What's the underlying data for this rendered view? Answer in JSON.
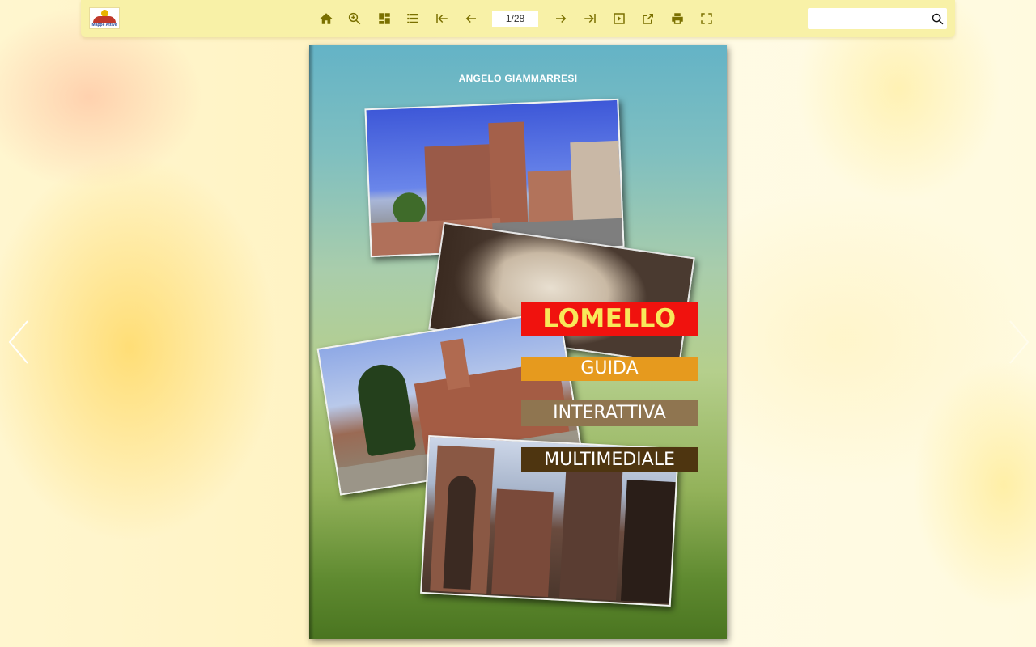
{
  "toolbar": {
    "logo_text": "Mappe Attive",
    "page_indicator": "1/28",
    "search_placeholder": "",
    "buttons": [
      {
        "name": "home",
        "icon": "home-icon"
      },
      {
        "name": "zoom",
        "icon": "zoom-in-icon"
      },
      {
        "name": "thumbnails",
        "icon": "thumbnails-icon"
      },
      {
        "name": "table-of-contents",
        "icon": "list-icon"
      },
      {
        "name": "first-page",
        "icon": "first-page-icon"
      },
      {
        "name": "previous-page",
        "icon": "arrow-left-icon"
      },
      {
        "name": "next-page",
        "icon": "arrow-right-icon"
      },
      {
        "name": "last-page",
        "icon": "last-page-icon"
      },
      {
        "name": "autoplay",
        "icon": "play-icon"
      },
      {
        "name": "share",
        "icon": "share-icon"
      },
      {
        "name": "print",
        "icon": "print-icon"
      },
      {
        "name": "fullscreen",
        "icon": "fullscreen-icon"
      }
    ]
  },
  "book": {
    "author": "ANGELO GIAMMARRESI",
    "title": "LOMELLO",
    "line1": "GUIDA",
    "line2": "INTERATTIVA",
    "line3": "MULTIMEDIALE"
  },
  "colors": {
    "toolbar_bg": "#f8f1a7",
    "icon": "#7a7000",
    "title_bg": "#f0120e",
    "title_text": "#f8e85a",
    "guida_bg": "#e69a1e",
    "interattiva_bg": "#8f7550",
    "multimediale_bg": "#4e3510"
  }
}
